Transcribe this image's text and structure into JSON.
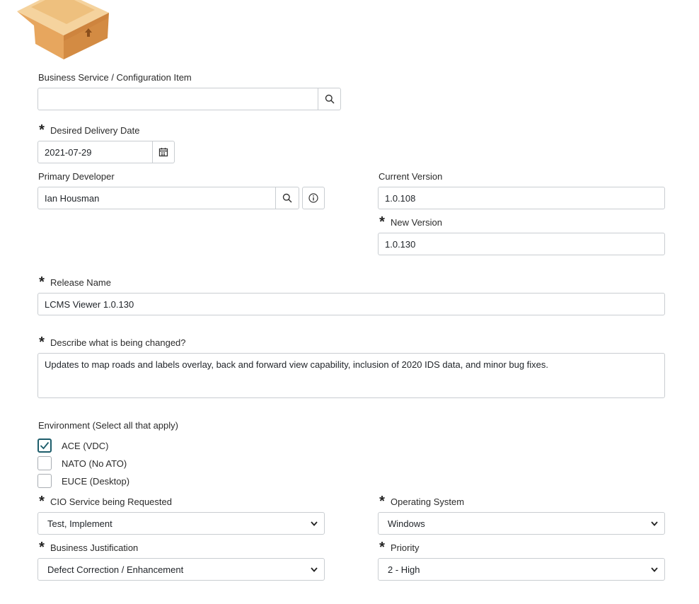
{
  "logo": {
    "icon": "package-box-icon"
  },
  "business_service": {
    "label": "Business Service / Configuration Item",
    "value": ""
  },
  "delivery_date": {
    "label": "Desired Delivery Date",
    "value": "2021-07-29"
  },
  "primary_developer": {
    "label": "Primary Developer",
    "value": "Ian Housman"
  },
  "current_version": {
    "label": "Current Version",
    "value": "1.0.108"
  },
  "new_version": {
    "label": "New Version",
    "value": "1.0.130"
  },
  "release_name": {
    "label": "Release Name",
    "value": "LCMS Viewer 1.0.130"
  },
  "description": {
    "label": "Describe what is being changed?",
    "value": "Updates to map roads and labels overlay, back and forward view capability, inclusion of 2020 IDS data, and minor bug fixes."
  },
  "environment": {
    "label": "Environment (Select all that apply)",
    "options": [
      {
        "label": "ACE (VDC)",
        "checked": true
      },
      {
        "label": "NATO (No ATO)",
        "checked": false
      },
      {
        "label": "EUCE (Desktop)",
        "checked": false
      }
    ]
  },
  "cio_service": {
    "label": "CIO Service being Requested",
    "value": "Test, Implement"
  },
  "operating_system": {
    "label": "Operating System",
    "value": "Windows"
  },
  "business_justification": {
    "label": "Business Justification",
    "value": "Defect Correction / Enhancement"
  },
  "priority": {
    "label": "Priority",
    "value": "2 - High"
  },
  "colors": {
    "check": "#1d5d6b",
    "border": "#c9cdd1",
    "box_light": "#f3cf95",
    "box_dark": "#d9944a"
  }
}
